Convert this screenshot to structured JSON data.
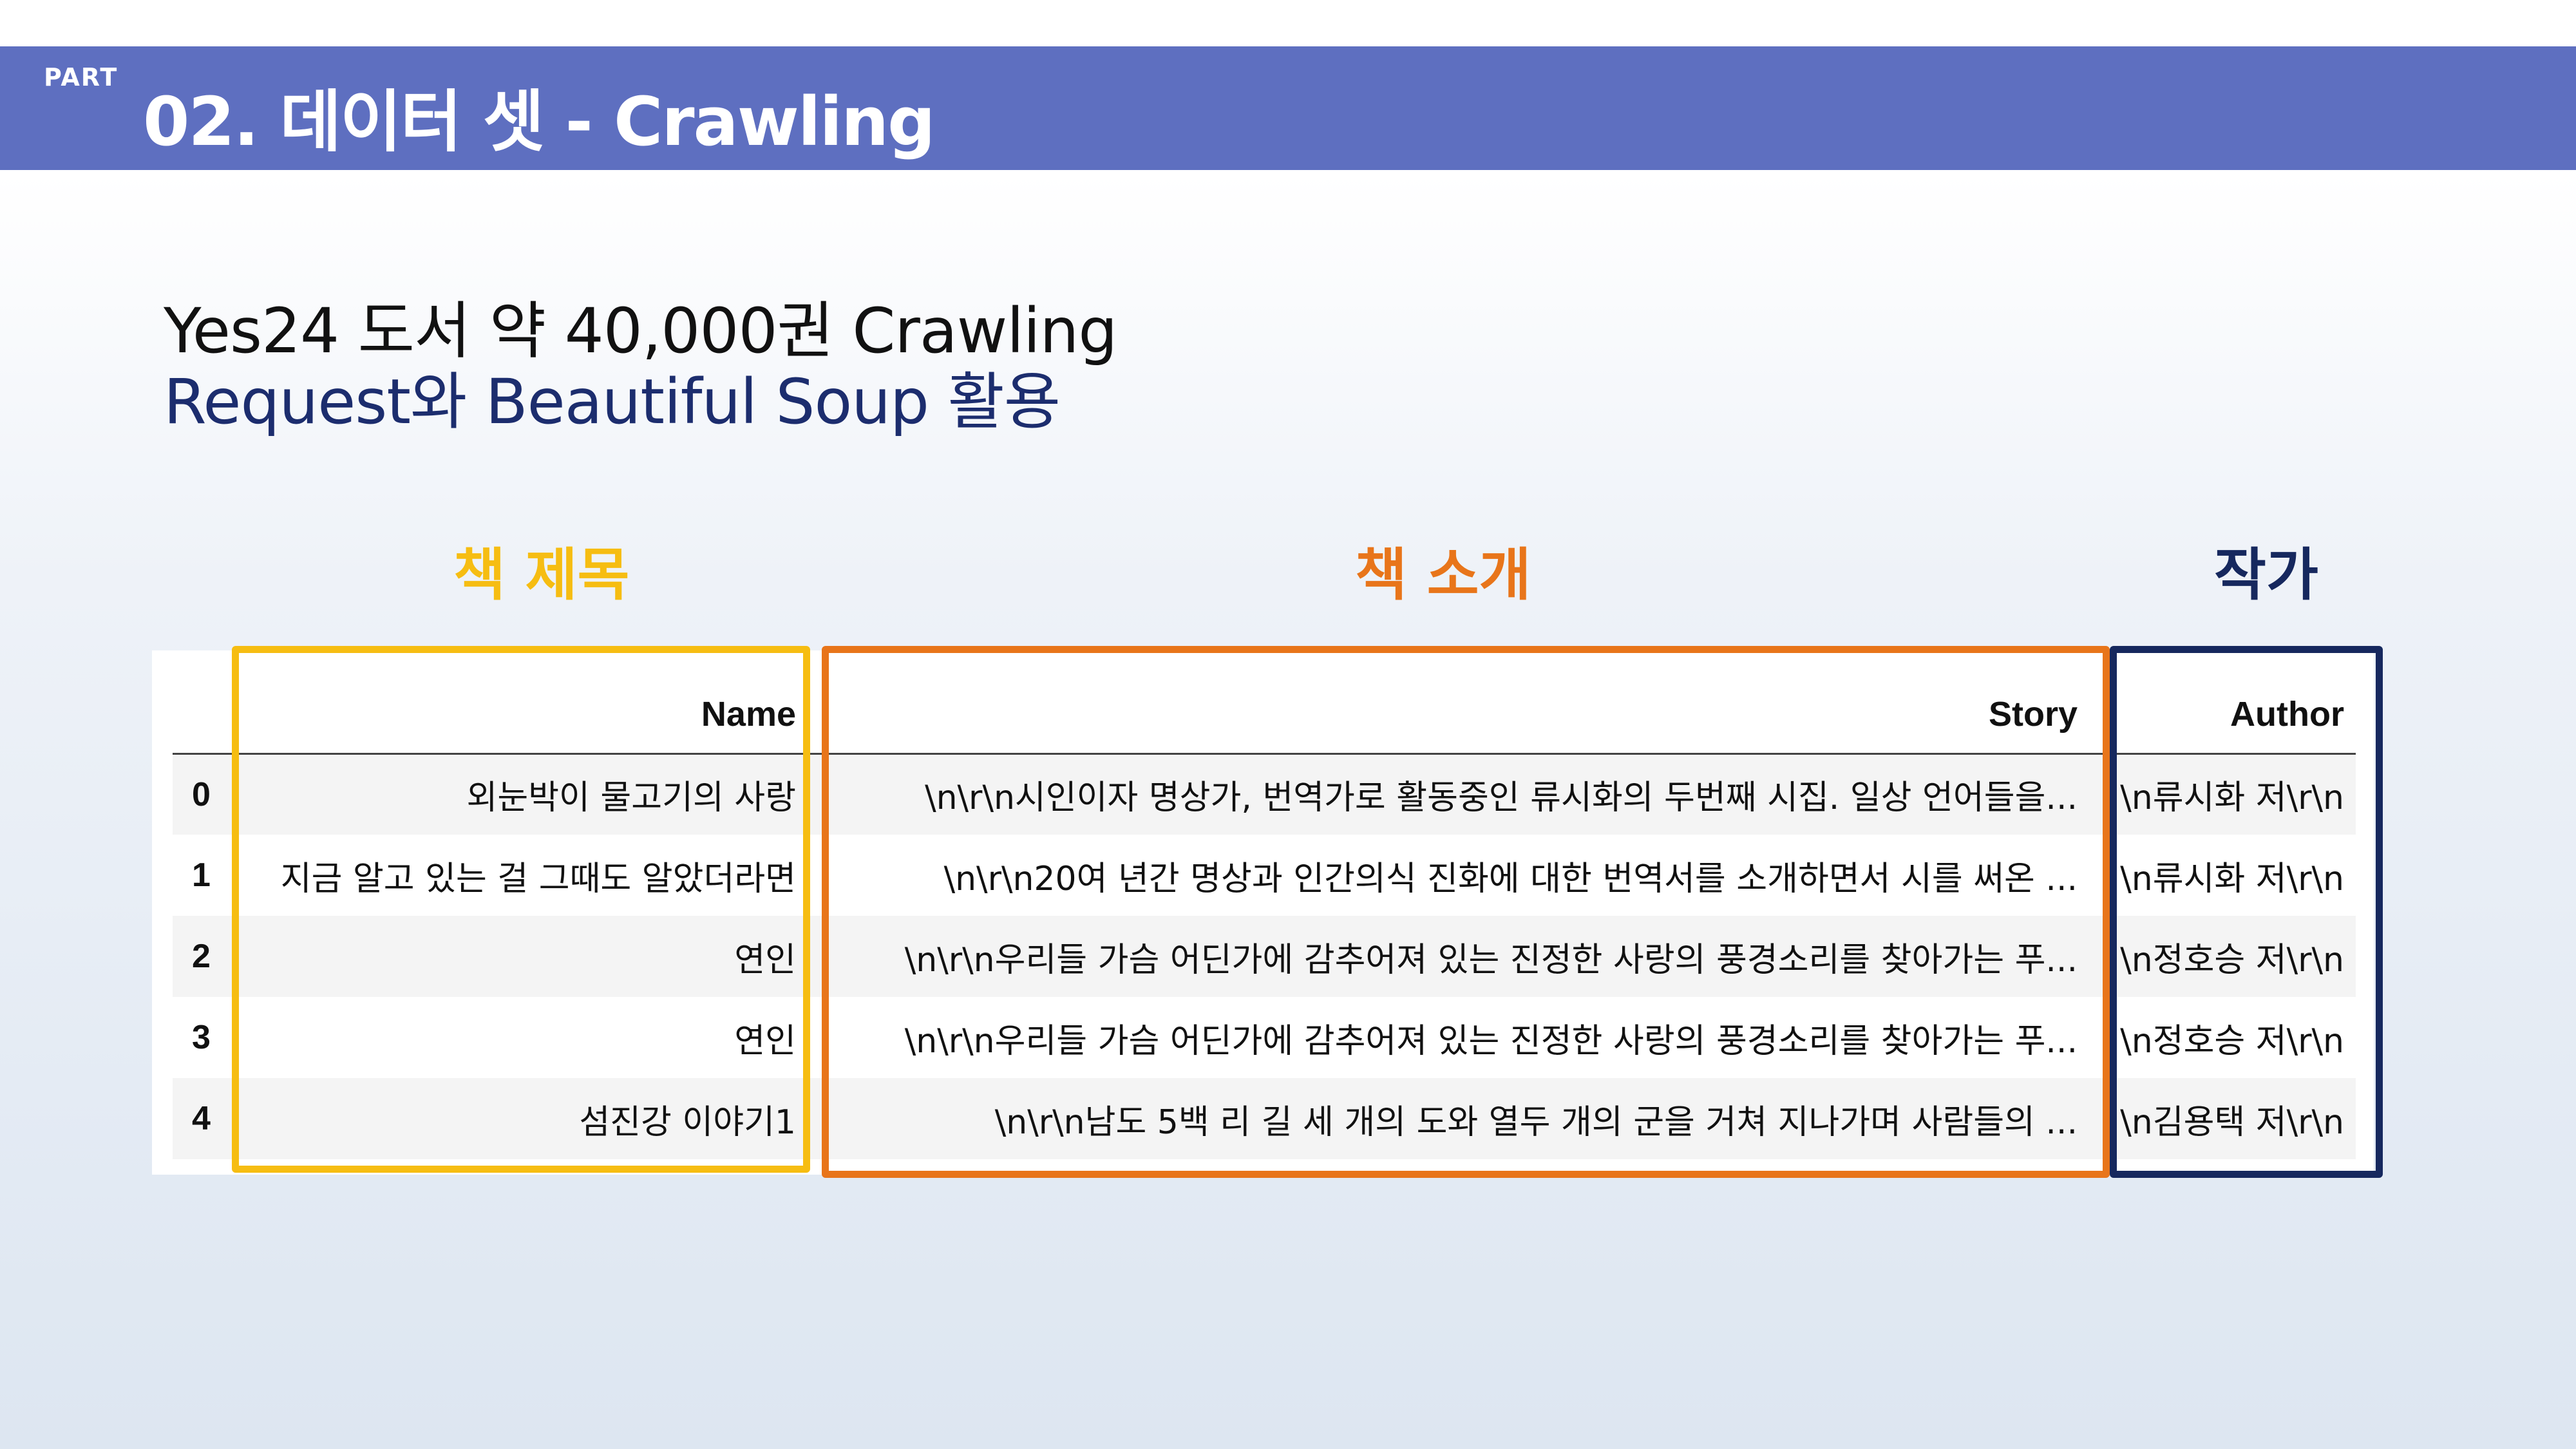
{
  "header": {
    "part_label": "PART",
    "title": "02. 데이터 셋 - Crawling",
    "bar_color": "#5e6fc0"
  },
  "body": {
    "line1": "Yes24 도서 약 40,000권 Crawling",
    "line2": "Request와 Beautiful Soup 활용"
  },
  "column_headings": {
    "title": "책 제목",
    "story": "책 소개",
    "author": "작가",
    "title_color": "#f6bd12",
    "story_color": "#e8751a",
    "author_color": "#16285e"
  },
  "table": {
    "headers": [
      "",
      "Name",
      "Story",
      "Author"
    ],
    "rows": [
      {
        "index": "0",
        "name": "외눈박이 물고기의 사랑",
        "story": "\\n\\r\\n시인이자 명상가, 번역가로 활동중인 류시화의 두번째 시집. 일상 언어들을...",
        "author": "\\n류시화 저\\r\\n"
      },
      {
        "index": "1",
        "name": "지금 알고 있는 걸 그때도 알았더라면",
        "story": "\\n\\r\\n20여 년간 명상과 인간의식 진화에 대한 번역서를 소개하면서 시를 써온 ...",
        "author": "\\n류시화 저\\r\\n"
      },
      {
        "index": "2",
        "name": "연인",
        "story": "\\n\\r\\n우리들 가슴 어딘가에 감추어져 있는 진정한 사랑의 풍경소리를 찾아가는 푸...",
        "author": "\\n정호승 저\\r\\n"
      },
      {
        "index": "3",
        "name": "연인",
        "story": "\\n\\r\\n우리들 가슴 어딘가에 감추어져 있는 진정한 사랑의 풍경소리를 찾아가는 푸...",
        "author": "\\n정호승 저\\r\\n"
      },
      {
        "index": "4",
        "name": "섬진강 이야기1",
        "story": "\\n\\r\\n남도 5백 리 길 세 개의 도와 열두 개의 군을 거쳐 지나가며 사람들의 ...",
        "author": "\\n김용택 저\\r\\n"
      }
    ]
  }
}
